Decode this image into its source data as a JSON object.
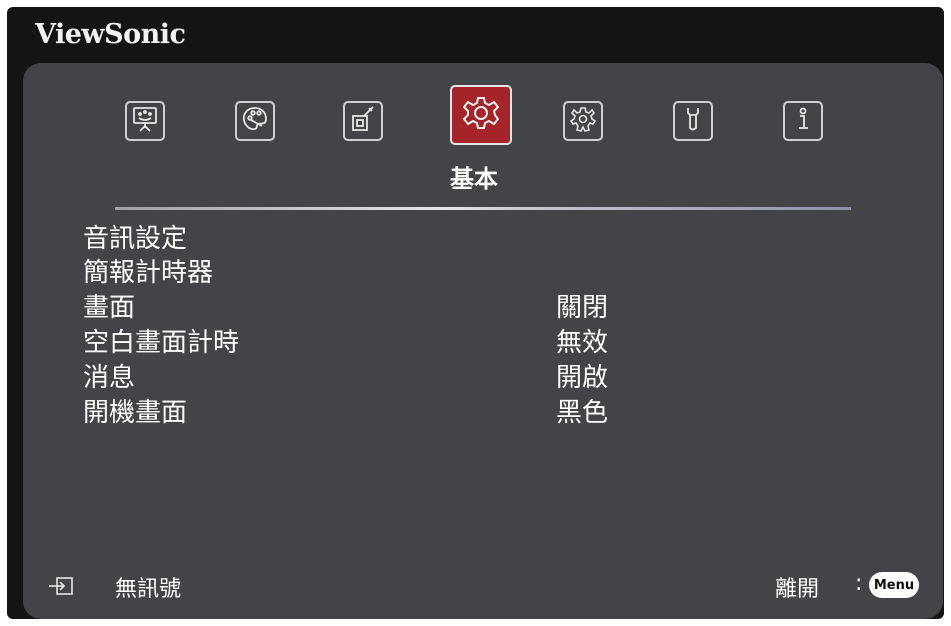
{
  "brand": "ViewSonic",
  "tabs": [
    {
      "icon": "display-icon",
      "active": false
    },
    {
      "icon": "palette-icon",
      "active": false
    },
    {
      "icon": "source-icon",
      "active": false
    },
    {
      "icon": "settings-gear-icon",
      "active": true
    },
    {
      "icon": "advanced-settings-icon",
      "active": false
    },
    {
      "icon": "wrench-icon",
      "active": false
    },
    {
      "icon": "info-icon",
      "active": false
    }
  ],
  "active_tab_title": "基本",
  "menu": [
    {
      "label": "音訊設定",
      "value": ""
    },
    {
      "label": "簡報計時器",
      "value": ""
    },
    {
      "label": "畫面",
      "value": "關閉"
    },
    {
      "label": "空白畫面計時",
      "value": "無效"
    },
    {
      "label": "消息",
      "value": "開啟"
    },
    {
      "label": "開機畫面",
      "value": "黑色"
    }
  ],
  "footer": {
    "status_icon": "input-source-icon",
    "status": "無訊號",
    "exit_label": "離開",
    "exit_separator": ":",
    "menu_button": "Menu"
  },
  "colors": {
    "background": "#141414",
    "panel": "#424447",
    "active_tab": "#a5242a",
    "text": "#ffffff"
  }
}
